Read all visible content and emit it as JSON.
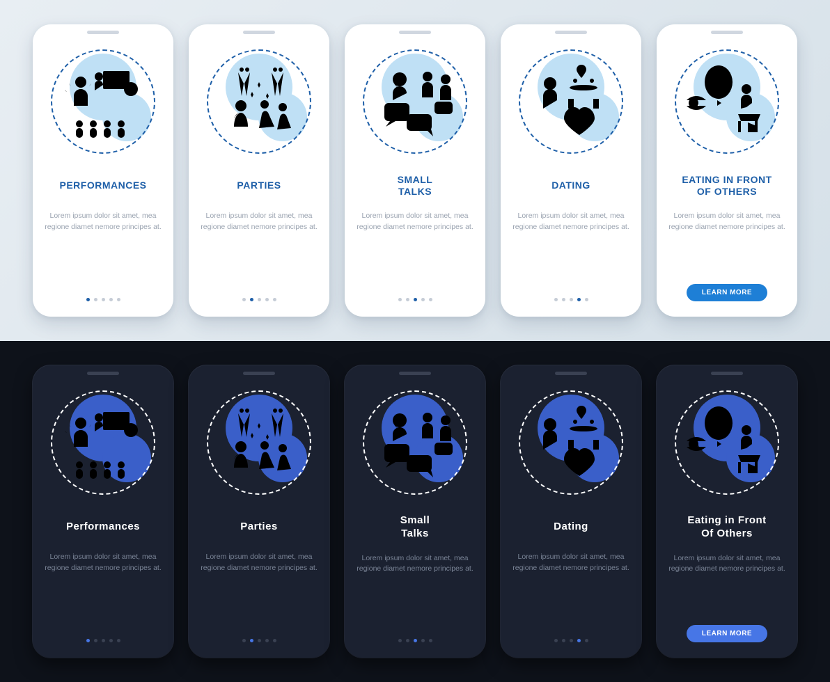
{
  "common": {
    "description": "Lorem ipsum dolor sit amet, mea regione diamet nemore principes at.",
    "cta_label": "LEARN MORE"
  },
  "light": {
    "screens": [
      {
        "title": "PERFORMANCES",
        "icon": "performances-icon",
        "active_dot": 0
      },
      {
        "title": "PARTIES",
        "icon": "parties-icon",
        "active_dot": 1
      },
      {
        "title": "SMALL\nTALKS",
        "icon": "small-talks-icon",
        "active_dot": 2
      },
      {
        "title": "DATING",
        "icon": "dating-icon",
        "active_dot": 3
      },
      {
        "title": "EATING IN FRONT\nOF OTHERS",
        "icon": "eating-icon",
        "active_dot": 4,
        "cta": true
      }
    ]
  },
  "dark": {
    "screens": [
      {
        "title": "Performances",
        "icon": "performances-icon",
        "active_dot": 0
      },
      {
        "title": "Parties",
        "icon": "parties-icon",
        "active_dot": 1
      },
      {
        "title": "Small\nTalks",
        "icon": "small-talks-icon",
        "active_dot": 2
      },
      {
        "title": "Dating",
        "icon": "dating-icon",
        "active_dot": 3
      },
      {
        "title": "Eating in Front\nOf Others",
        "icon": "eating-icon",
        "active_dot": 4,
        "cta": true
      }
    ]
  }
}
